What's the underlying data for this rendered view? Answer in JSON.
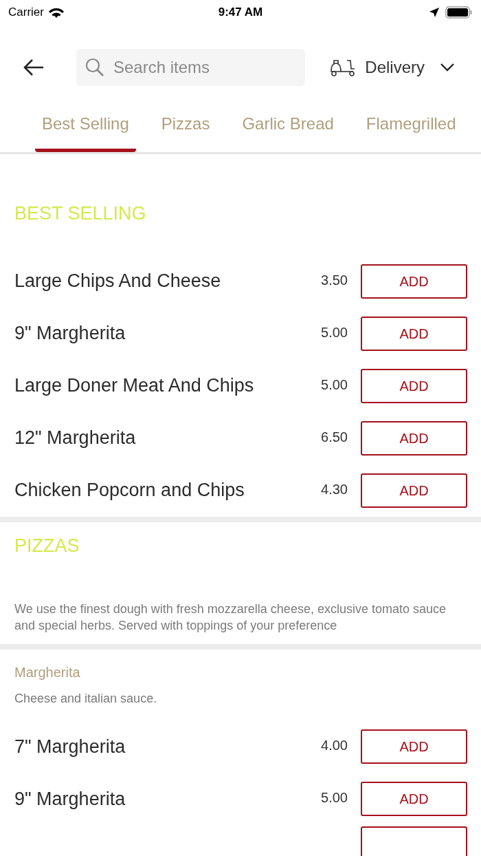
{
  "status_bar": {
    "carrier": "Carrier",
    "time": "9:47 AM"
  },
  "header": {
    "search": {
      "placeholder": "Search items"
    },
    "mode": "Delivery"
  },
  "tabs": [
    {
      "label": "Best Selling",
      "selected": true
    },
    {
      "label": "Pizzas",
      "selected": false
    },
    {
      "label": "Garlic Bread",
      "selected": false
    },
    {
      "label": "Flamegrilled",
      "selected": false
    }
  ],
  "sections": [
    {
      "title": "BEST SELLING",
      "groups": [
        {
          "items": [
            {
              "kind": "item",
              "name": "Large Chips And Cheese",
              "price": "3.50",
              "button": "ADD"
            },
            {
              "kind": "item",
              "name": "9\" Margherita",
              "price": "5.00",
              "button": "ADD"
            },
            {
              "kind": "item",
              "name": "Large Doner Meat And Chips",
              "price": "5.00",
              "button": "ADD"
            },
            {
              "kind": "item",
              "name": "12\" Margherita",
              "price": "6.50",
              "button": "ADD"
            },
            {
              "kind": "item",
              "name": "Chicken Popcorn and Chips",
              "price": "4.30",
              "button": "ADD"
            }
          ]
        }
      ]
    },
    {
      "title": "PIZZAS",
      "description": "We use the finest dough with fresh mozzarella cheese, exclusive tomato sauce and special herbs. Served with toppings of your preference",
      "groups": [
        {
          "name": "Margherita",
          "description": "Cheese and italian sauce.",
          "items": [
            {
              "kind": "item",
              "name": "7\" Margherita",
              "price": "4.00",
              "button": "ADD"
            },
            {
              "kind": "item",
              "name": "9\" Margherita",
              "price": "5.00",
              "button": "ADD"
            },
            {
              "kind": "cut_off"
            }
          ]
        }
      ]
    }
  ]
}
